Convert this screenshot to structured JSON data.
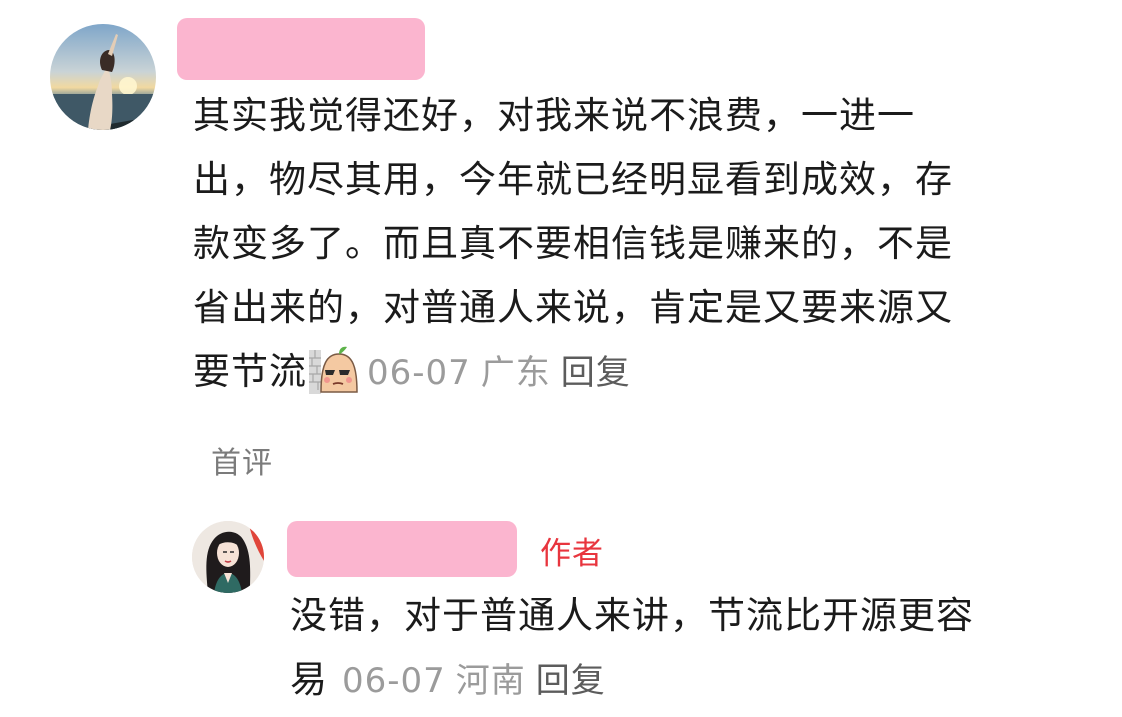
{
  "comment": {
    "avatar_icon": "user-avatar-sunset-photo",
    "username_redacted": true,
    "lines": [
      "其实我觉得还好，对我来说不浪费，一进一",
      "出，物尽其用，今年就已经明显看到成效，存",
      "款变多了。而且真不要相信钱是赚来的，不是",
      "省出来的，对普通人来说，肯定是又要来源又",
      "要节流"
    ],
    "sticker_icon": "peeking-potato-sticker",
    "date": "06-07",
    "location": "广东",
    "reply_label": "回复",
    "tag": "首评"
  },
  "reply": {
    "avatar_icon": "author-avatar-illustrated-woman",
    "username_redacted": true,
    "author_badge": "作者",
    "lines": [
      "没错，对于普通人来讲，节流比开源更容",
      "易"
    ],
    "date": "06-07",
    "location": "河南",
    "reply_label": "回复"
  },
  "colors": {
    "redaction": "#fbb5cf",
    "meta_text": "#9b9b9b",
    "author_badge": "#e8353e",
    "body_text": "#1b1b1b"
  }
}
